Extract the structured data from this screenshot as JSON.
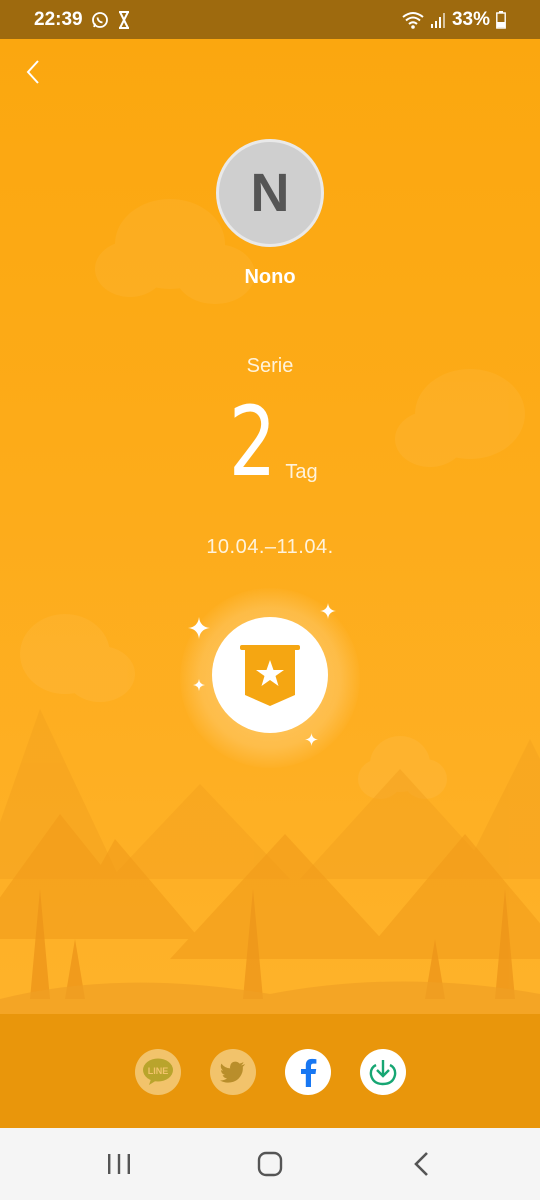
{
  "status_bar": {
    "time": "22:39",
    "battery": "33%"
  },
  "profile": {
    "initial": "N",
    "name": "Nono"
  },
  "streak": {
    "label": "Serie",
    "count": "2",
    "unit": "Tag",
    "date_range": "10.04.–11.04."
  },
  "share": {
    "line_label": "LINE"
  },
  "colors": {
    "background": "#FBA70F",
    "share_bar": "#E9960B",
    "badge_gold": "#F5A612",
    "facebook_blue": "#1877F2",
    "download_green": "#17A673"
  }
}
